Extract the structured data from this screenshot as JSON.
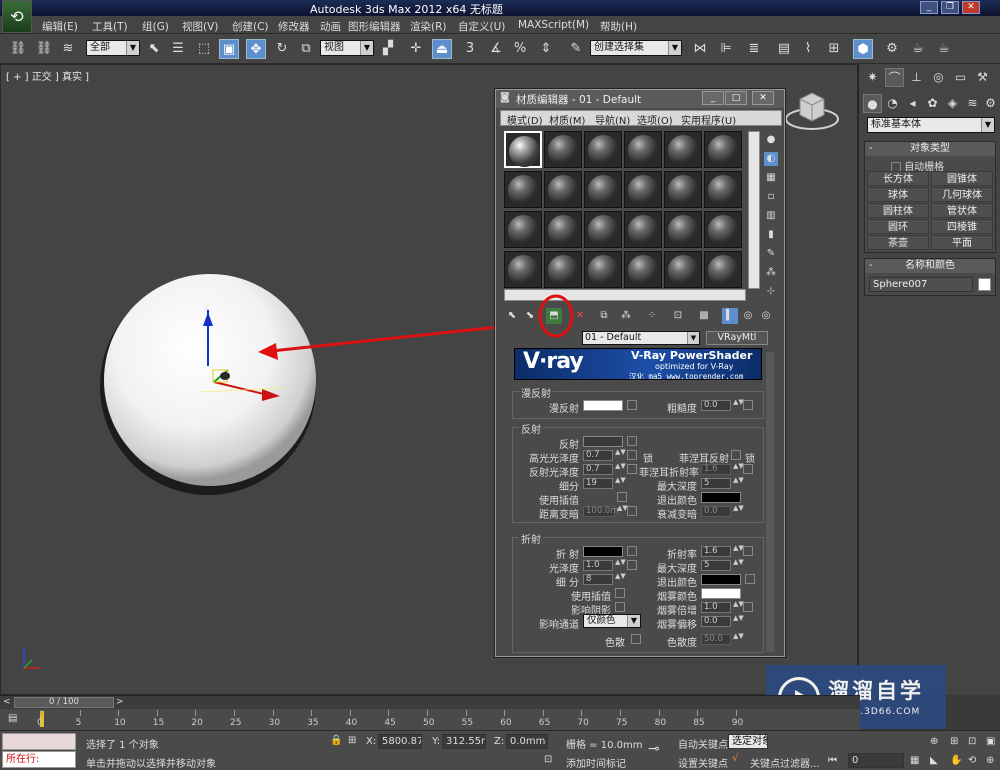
{
  "app": {
    "title": "Autodesk 3ds Max  2012 x64    无标题"
  },
  "menu": [
    "编辑(E)",
    "工具(T)",
    "组(G)",
    "视图(V)",
    "创建(C)",
    "修改器",
    "动画",
    "图形编辑器",
    "渲染(R)",
    "自定义(U)",
    "MAXScript(M)",
    "帮助(H)"
  ],
  "toolbar": {
    "filter": "全部",
    "refcoord": "视图",
    "selset": "创建选择集",
    "snap3": "3",
    "percent": "%"
  },
  "viewport": {
    "label": "[ + ] 正交 ] 真实 ]"
  },
  "command_panel": {
    "category": "标准基本体",
    "object_type": {
      "title": "对象类型",
      "autogrid": "自动栅格",
      "buttons": [
        "长方体",
        "圆锥体",
        "球体",
        "几何球体",
        "圆柱体",
        "管状体",
        "圆环",
        "四棱锥",
        "茶壶",
        "平面"
      ]
    },
    "name_color": {
      "title": "名称和颜色",
      "name": "Sphere007",
      "color": "#ffffff"
    }
  },
  "material_editor": {
    "title": "材质编辑器 - 01 - Default",
    "menu": [
      "模式(D)",
      "材质(M)",
      "导航(N)",
      "选项(O)",
      "实用程序(U)"
    ],
    "material_name": "01 - Default",
    "material_type": "VRayMtl",
    "banner": {
      "logo": "V·ray",
      "title": "V-Ray PowerShader",
      "subtitle": "optimized for V-Ray",
      "credit": "汉化 ma5 www.toprender.com"
    },
    "diffuse": {
      "group": "漫反射",
      "diffuse_label": "漫反射",
      "diffuse_color": "#ffffff",
      "roughness_label": "粗糙度",
      "roughness": "0.0"
    },
    "reflection": {
      "group": "反射",
      "reflect_label": "反射",
      "reflect_color": "#3a3a3a",
      "hilight_gloss_label": "高光光泽度",
      "hilight_gloss": "0.7",
      "lock_label": "锁",
      "fresnel_label": "菲涅耳反射",
      "refl_gloss_label": "反射光泽度",
      "refl_gloss": "0.7",
      "fresnel_ior_label": "菲涅耳折射率",
      "fresnel_ior": "1.6",
      "subdivs_label": "细分",
      "subdivs": "19",
      "max_depth_label": "最大深度",
      "max_depth": "5",
      "interp_label": "使用插值",
      "exit_color_label": "退出颜色",
      "dim_dist_label": "距离变暗",
      "dim_dist": "100.0m",
      "dim_falloff_label": "衰减变暗",
      "dim_falloff": "0.0"
    },
    "refraction": {
      "group": "折射",
      "refract_label": "折 射",
      "ior_label": "折射率",
      "ior": "1.6",
      "gloss_label": "光泽度",
      "gloss": "1.0",
      "max_depth_label": "最大深度",
      "max_depth": "5",
      "subdivs_label": "细 分",
      "subdivs": "8",
      "exit_color_label": "退出颜色",
      "interp_label": "使用插值",
      "fog_color_label": "烟雾颜色",
      "fog_color": "#ffffff",
      "shadows_label": "影响阴影",
      "fog_mult_label": "烟雾倍增",
      "fog_mult": "1.0",
      "channels_label": "影响通道",
      "channels": "仅颜色",
      "fog_bias_label": "烟雾偏移",
      "fog_bias": "0.0",
      "dispersion_label": "色散",
      "abbe_label": "色散度",
      "abbe": "50.0"
    }
  },
  "timeline": {
    "frame": "0 / 100",
    "ticks": [
      "0",
      "5",
      "10",
      "15",
      "20",
      "25",
      "30",
      "35",
      "40",
      "45",
      "50",
      "55",
      "60",
      "65",
      "70",
      "75",
      "80",
      "85",
      "90"
    ]
  },
  "status": {
    "mode": "所在行:",
    "selection": "选择了 1 个对象",
    "prompt": "单击并拖动以选择并移动对象",
    "x_label": "X:",
    "x": "5800.875m",
    "y_label": "Y:",
    "y": "312.55mm",
    "z_label": "Z:",
    "z": "0.0mm",
    "grid": "栅格 = 10.0mm",
    "add_key": "添加时间标记",
    "autokey": "自动关键点",
    "setkey": "设置关键点",
    "selected": "选定对象",
    "key_filters": "关键点过滤器...",
    "frame": "0"
  },
  "watermark": {
    "name": "溜溜自学",
    "url": "ZIXUE.3D66.COM"
  },
  "colors": {
    "annotation": "#dd1111",
    "accent": "#5e8fcc"
  }
}
